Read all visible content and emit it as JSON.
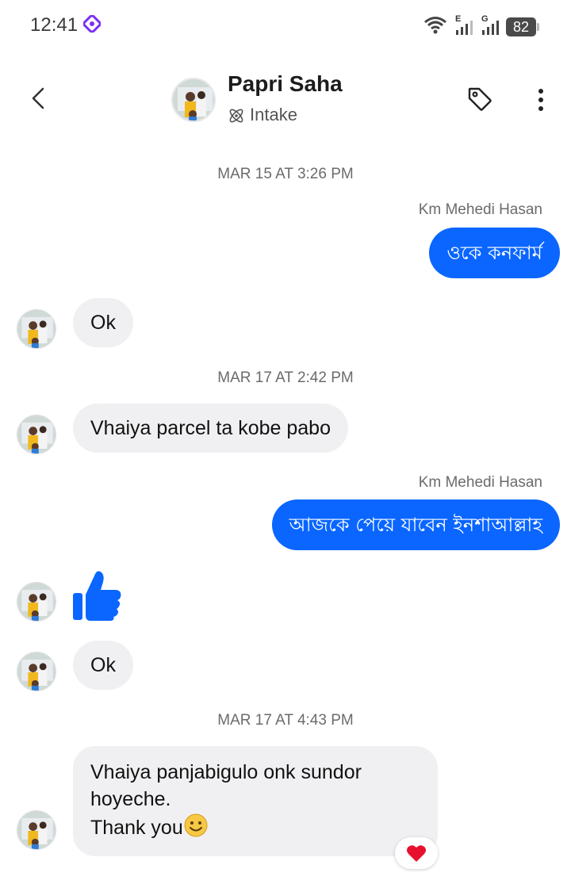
{
  "status_bar": {
    "time": "12:41",
    "net1": "E",
    "net2": "G",
    "battery": "82"
  },
  "header": {
    "name": "Papri Saha",
    "subtitle": "Intake"
  },
  "messages": {
    "ts1": "MAR 15 AT 3:26 PM",
    "sender1": "Km Mehedi Hasan",
    "out1": "ওকে কনফার্ম",
    "in1": "Ok",
    "ts2": "MAR 17 AT 2:42 PM",
    "in2": "Vhaiya parcel ta kobe pabo",
    "sender2": "Km Mehedi Hasan",
    "out2": "আজকে পেয়ে যাবেন ইনশাআল্লাহ",
    "in3": "Ok",
    "ts3": "MAR 17 AT 4:43 PM",
    "in4_line1": "Vhaiya panjabigulo onk sundor hoyeche.",
    "in4_line2": "Thank you"
  },
  "colors": {
    "accent": "#0a66ff",
    "incoming_bubble": "#f0f0f2",
    "reaction_heart": "#e8112d"
  },
  "icons": {
    "back": "chevron-left-icon",
    "tag": "tag-icon",
    "more": "more-vertical-icon",
    "intake": "atom-icon",
    "thumb": "thumbs-up-icon",
    "reaction": "heart-icon",
    "emoji": "smiling-face-icon"
  }
}
